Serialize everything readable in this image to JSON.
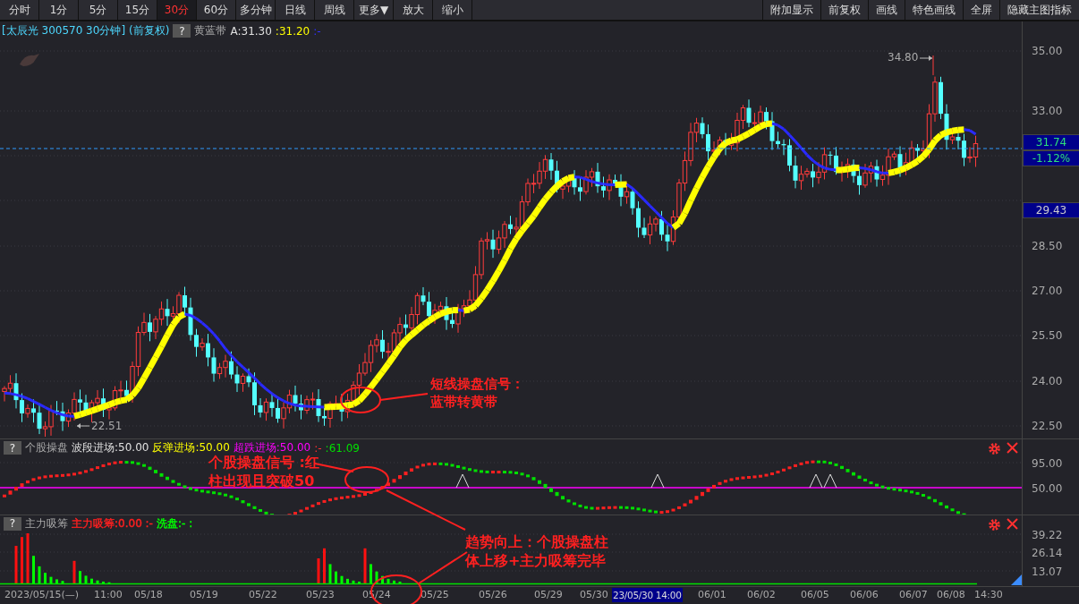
{
  "toolbar": {
    "periods": [
      {
        "label": "分时",
        "selected": false
      },
      {
        "label": "1分",
        "selected": false
      },
      {
        "label": "5分",
        "selected": false
      },
      {
        "label": "15分",
        "selected": false
      },
      {
        "label": "30分",
        "selected": true
      },
      {
        "label": "60分",
        "selected": false
      },
      {
        "label": "多分钟",
        "selected": false
      },
      {
        "label": "日线",
        "selected": false
      },
      {
        "label": "周线",
        "selected": false
      },
      {
        "label": "更多▼",
        "selected": false
      },
      {
        "label": "放大",
        "selected": false
      },
      {
        "label": "缩小",
        "selected": false
      }
    ],
    "actions": [
      "附加显示",
      "前复权",
      "画线",
      "特色画线",
      "全屏",
      "隐藏主图指标"
    ]
  },
  "main_chart": {
    "title": "[太辰光 300570 30分钟]",
    "adjust": "(前复权)",
    "help": "?",
    "indicator": "黄蓝带",
    "legend": [
      {
        "text": "A:31.30",
        "color": "#e0e0e0"
      },
      {
        "text": ":31.20",
        "color": "#ffff00"
      },
      {
        "text": ":-",
        "color": "#3030ff"
      }
    ],
    "price_ticks": [
      "35.00",
      "33.00",
      "28.50",
      "27.00",
      "25.50",
      "24.00",
      "22.50"
    ],
    "last_price": "31.74",
    "change": "-1.12%",
    "cursor_price": "29.43",
    "high_label": "34.80",
    "low_label": "22.51",
    "annotation": [
      "短线操盘信号：",
      "蓝带转黄带"
    ]
  },
  "indicator_1": {
    "help": "?",
    "name": "个股操盘",
    "legend": [
      {
        "text": "波段进场:50.00",
        "color": "#e0e0e0"
      },
      {
        "text": "反弹进场:50.00",
        "color": "#ffff00"
      },
      {
        "text": "超跌进场:50.00",
        "color": "#ff00ff"
      },
      {
        "text": ":-",
        "color": "#ff3030"
      },
      {
        "text": ":61.09",
        "color": "#00e000"
      }
    ],
    "ticks": [
      "95.00",
      "50.00"
    ],
    "annotation": [
      "个股操盘信号 :红",
      "柱出现且突破50"
    ]
  },
  "indicator_2": {
    "help": "?",
    "name": "主力吸筹",
    "legend": [
      {
        "text": "主力吸筹:0.00 :-",
        "color": "#ff2020"
      },
      {
        "text": "洗盘:- :",
        "color": "#00ff00"
      }
    ],
    "ticks": [
      "39.22",
      "26.14",
      "13.07"
    ],
    "annotation": [
      "趋势向上：个股操盘柱",
      "体上移+主力吸筹完毕"
    ]
  },
  "date_axis": {
    "labels": [
      "2023/05/15(—)",
      "11:00",
      "05/18",
      "05/19",
      "05/22",
      "05/23",
      "05/24",
      "05/25",
      "05/26",
      "05/29",
      "05/30",
      "06/01",
      "06/02",
      "06/05",
      "06/06",
      "06/07",
      "06/08",
      "14:30"
    ],
    "cursor_label": "23/05/30 14:00"
  }
}
